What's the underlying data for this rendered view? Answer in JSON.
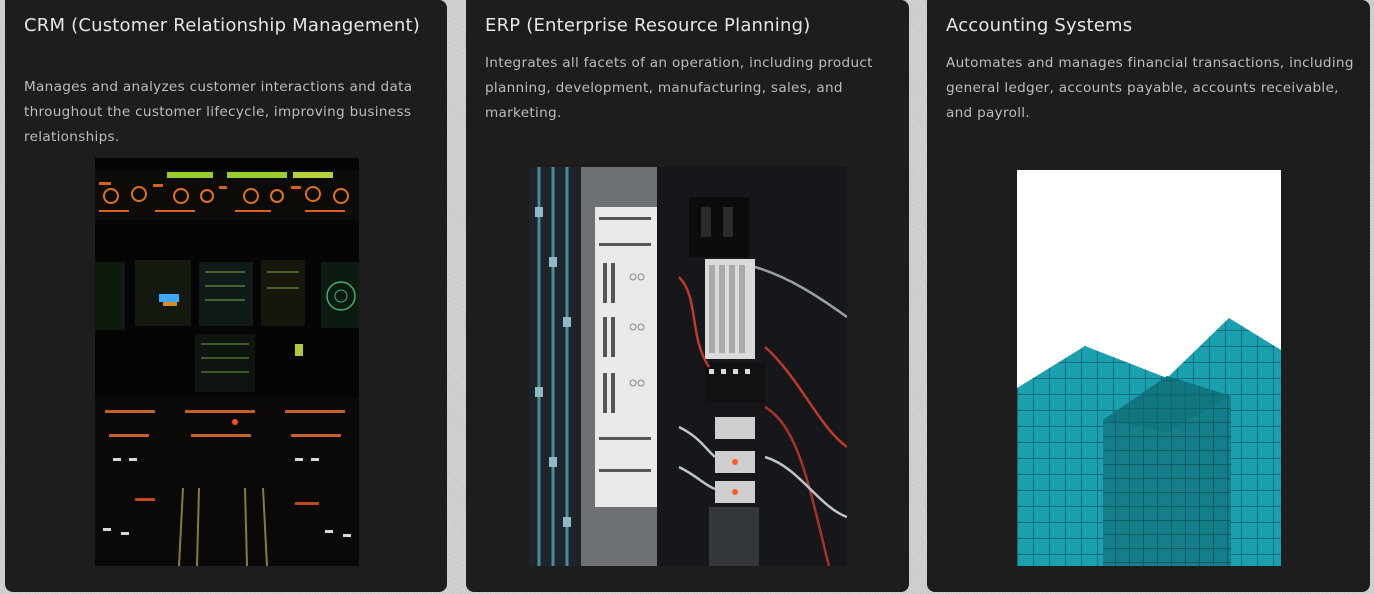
{
  "cards": [
    {
      "title": "CRM (Customer Relationship Management)",
      "description": "Manages and analyzes customer interactions and data throughout the customer lifecycle, improving business relationships.",
      "image": "aircraft-cockpit-photo"
    },
    {
      "title": "ERP (Enterprise Resource Planning)",
      "description": "Integrates all facets of an operation, including product planning, development, manufacturing, sales, and marketing.",
      "image": "electrical-panel-photo"
    },
    {
      "title": "Accounting Systems",
      "description": "Automates and manages financial transactions, including general ledger, accounts payable, accounts receivable, and payroll.",
      "image": "glass-building-photo"
    }
  ],
  "colors": {
    "card_bg": "#1d1d1d",
    "title": "#e6e6e6",
    "text": "#bdbdbd",
    "building_teal": "#1aa6b4"
  }
}
